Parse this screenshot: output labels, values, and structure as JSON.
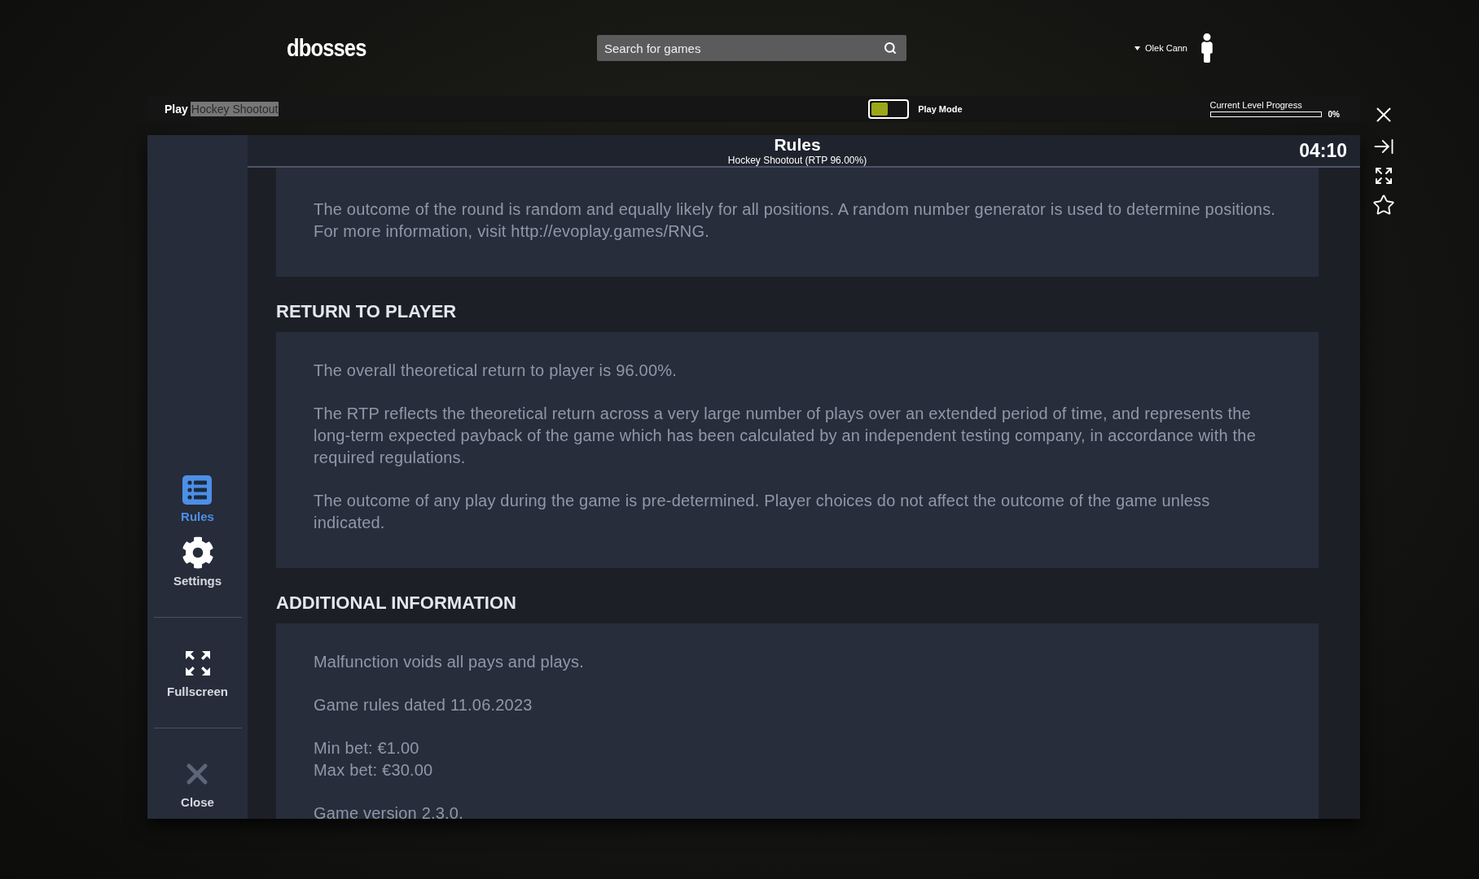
{
  "header": {
    "logo": "dbosses",
    "search": {
      "placeholder": "Search for games"
    },
    "user": {
      "name": "Olek Cann"
    }
  },
  "play_bar": {
    "label": "Play",
    "game": "Hockey Shootout",
    "game_highlighted": true,
    "play_mode": {
      "label": "Play Mode",
      "on": false
    },
    "progress": {
      "label": "Current Level Progress",
      "level": 0,
      "reading": "0%"
    }
  },
  "sidebar": {
    "items": [
      {
        "kind": "rules",
        "label": "Rules",
        "selected": true
      },
      {
        "kind": "settings",
        "label": "Settings",
        "selected": false
      },
      {
        "kind": "fullscreen",
        "label": "Fullscreen",
        "selected": false
      },
      {
        "kind": "close",
        "label": "Close",
        "selected": false
      }
    ]
  },
  "rules": {
    "title": "Rules",
    "subtitle": "Hockey Shootout (RTP 96.00%)",
    "timer": "04:10",
    "sections": [
      {
        "paragraphs": [
          "The outcome of the round is random and equally likely for all positions. A random number generator is used to determine positions. For more information, visit http://evoplay.games/RNG."
        ]
      },
      {
        "heading": "RETURN TO PLAYER",
        "paragraphs": [
          "The overall theoretical return to player is 96.00%.",
          "The RTP reflects the theoretical return across a very large number of plays over an extended period of time, and represents the long-term expected payback of the game which has been calculated by an independent testing company, in accordance with the required regulations.",
          "The outcome of any play during the game is pre-determined. Player choices do not affect the outcome of the game unless indicated."
        ]
      },
      {
        "heading": "ADDITIONAL INFORMATION",
        "paragraphs": [
          "Malfunction voids all pays and plays.",
          "Game rules dated 11.06.2023",
          "Min bet: €1.00\nMax bet: €30.00",
          "Game version 2.3.0."
        ]
      }
    ]
  },
  "side_tools": [
    {
      "kind": "close"
    },
    {
      "kind": "collapse"
    },
    {
      "kind": "fullscreen"
    },
    {
      "kind": "favorite"
    }
  ]
}
